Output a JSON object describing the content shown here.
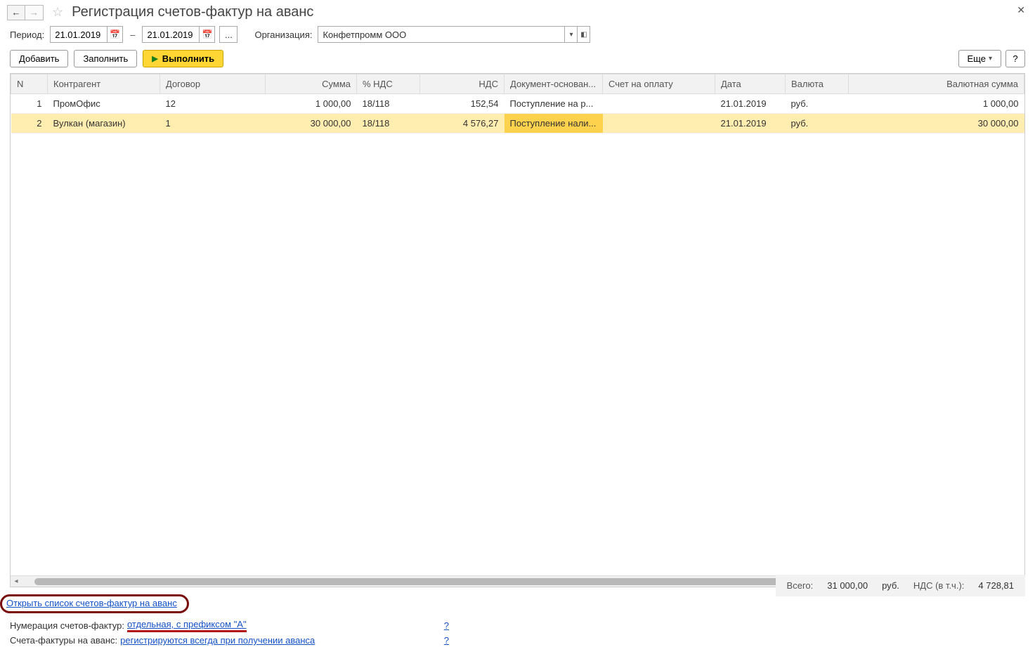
{
  "header": {
    "title": "Регистрация счетов-фактур на аванс"
  },
  "filter": {
    "period_label": "Период:",
    "date_from": "21.01.2019",
    "date_to": "21.01.2019",
    "dash": "–",
    "dots": "...",
    "org_label": "Организация:",
    "org_value": "Конфетпромм ООО"
  },
  "toolbar": {
    "add": "Добавить",
    "fill": "Заполнить",
    "exec": "Выполнить",
    "more": "Еще",
    "help": "?"
  },
  "columns": {
    "n": "N",
    "kontragent": "Контрагент",
    "dogovor": "Договор",
    "summa": "Сумма",
    "nds_pct": "% НДС",
    "nds": "НДС",
    "doc_basis": "Документ-основан...",
    "invoice": "Счет на оплату",
    "date": "Дата",
    "currency": "Валюта",
    "cur_sum": "Валютная сумма"
  },
  "rows": [
    {
      "n": "1",
      "kontragent": "ПромОфис",
      "dogovor": "12",
      "summa": "1 000,00",
      "nds_pct": "18/118",
      "nds": "152,54",
      "doc_basis": "Поступление на р...",
      "invoice": "",
      "date": "21.01.2019",
      "currency": "руб.",
      "cur_sum": "1 000,00",
      "selected": false
    },
    {
      "n": "2",
      "kontragent": "Вулкан (магазин)",
      "dogovor": "1",
      "summa": "30 000,00",
      "nds_pct": "18/118",
      "nds": "4 576,27",
      "doc_basis": "Поступление нали...",
      "invoice": "",
      "date": "21.01.2019",
      "currency": "руб.",
      "cur_sum": "30 000,00",
      "selected": true
    }
  ],
  "footer": {
    "open_link": "Открыть список счетов-фактур на аванс",
    "totals_label": "Всего:",
    "totals_sum": "31 000,00",
    "totals_cur": "руб.",
    "totals_nds_label": "НДС (в т.ч.):",
    "totals_nds": "4 728,81",
    "numbering_label": "Нумерация счетов-фактур:",
    "numbering_value": "отдельная, с префиксом \"А\"",
    "advance_label": "Счета-фактуры на аванс:",
    "advance_value": "регистрируются всегда при получении аванса",
    "qmark": "?"
  }
}
